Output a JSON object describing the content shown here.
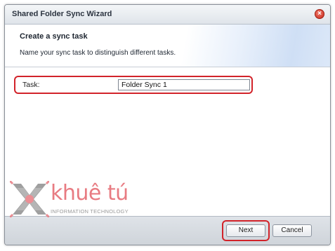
{
  "window": {
    "title": "Shared Folder Sync Wizard"
  },
  "header": {
    "title": "Create a sync task",
    "description": "Name your sync task to distinguish different tasks."
  },
  "form": {
    "task_label": "Task:",
    "task_value": "Folder Sync 1"
  },
  "footer": {
    "next_label": "Next",
    "cancel_label": "Cancel"
  },
  "watermark": {
    "brand": "khuê tú",
    "subtitle": "INFORMATION TECHNOLOGY",
    "color": "#e87b82"
  },
  "colors": {
    "highlight": "#d2232a",
    "close_button": "#c62a1b"
  },
  "icons": {
    "close": "close-icon",
    "logo": "x-logo-icon"
  }
}
